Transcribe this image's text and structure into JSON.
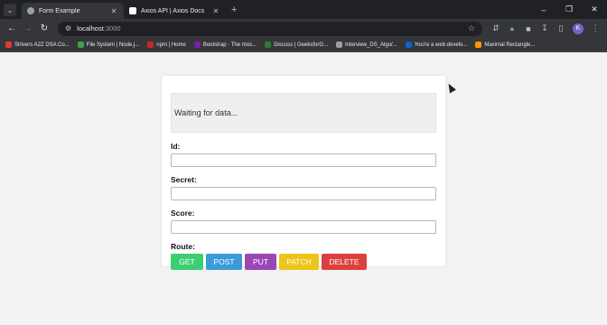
{
  "browser": {
    "tabs": [
      {
        "title": "Form Example",
        "favicon_color": "#9aa0a6",
        "active": true
      },
      {
        "title": "Axios API | Axios Docs",
        "favicon_color": "#ffffff",
        "active": false
      }
    ],
    "omnibox": {
      "host": "localhost",
      "port": ":3000"
    },
    "profile_initial": "K",
    "bookmarks": [
      {
        "label": "Strivers A2Z DSA Co...",
        "icon_color": "#e53935"
      },
      {
        "label": "File System | Node.j...",
        "icon_color": "#43a047"
      },
      {
        "label": "npm | Home",
        "icon_color": "#c62828"
      },
      {
        "label": "Bootstrap · The mos...",
        "icon_color": "#7b1fa2"
      },
      {
        "label": "Discuss | GeeksforG...",
        "icon_color": "#2e7d32"
      },
      {
        "label": "Interview_DS_Algo/...",
        "icon_color": "#9e9e9e"
      },
      {
        "label": "You're a web develo...",
        "icon_color": "#0a66c2"
      },
      {
        "label": "Maximal Rectangle...",
        "icon_color": "#ff9800"
      }
    ]
  },
  "form": {
    "output_text": "Waiting for data...",
    "id_label": "Id:",
    "secret_label": "Secret:",
    "score_label": "Score:",
    "route_label": "Route:",
    "id_value": "",
    "secret_value": "",
    "score_value": ""
  },
  "buttons": [
    {
      "label": "GET",
      "color": "#3ccf72"
    },
    {
      "label": "POST",
      "color": "#3a9bd8"
    },
    {
      "label": "PUT",
      "color": "#9a47b3"
    },
    {
      "label": "PATCH",
      "color": "#efc418"
    },
    {
      "label": "DELETE",
      "color": "#dd3f3f"
    }
  ]
}
